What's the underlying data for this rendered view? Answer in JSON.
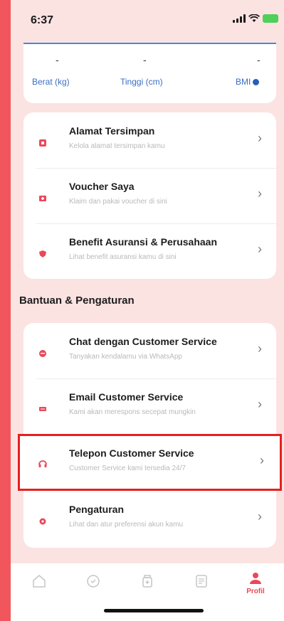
{
  "status_bar": {
    "time": "6:37"
  },
  "metrics": {
    "weight": {
      "value": "-",
      "label": "Berat (kg)"
    },
    "height": {
      "value": "-",
      "label": "Tinggi (cm)"
    },
    "bmi": {
      "value": "-",
      "label": "BMI"
    }
  },
  "account_menu": [
    {
      "title": "Alamat Tersimpan",
      "subtitle": "Kelola alamat tersimpan kamu",
      "icon": "location-icon"
    },
    {
      "title": "Voucher Saya",
      "subtitle": "Klaim dan pakai voucher di sini",
      "icon": "voucher-icon"
    },
    {
      "title": "Benefit Asuransi & Perusahaan",
      "subtitle": "Lihat benefit asuransi kamu di sini",
      "icon": "shield-icon"
    }
  ],
  "help_section": {
    "title": "Bantuan & Pengaturan",
    "items": [
      {
        "title": "Chat dengan Customer Service",
        "subtitle": "Tanyakan kendalamu via WhatsApp",
        "icon": "chat-icon"
      },
      {
        "title": "Email Customer Service",
        "subtitle": "Kami akan merespons secepat mungkin",
        "icon": "email-icon"
      },
      {
        "title": "Telepon Customer Service",
        "subtitle": "Customer Service kami tersedia 24/7",
        "icon": "headset-icon"
      },
      {
        "title": "Pengaturan",
        "subtitle": "Lihat dan atur preferensi akun kamu",
        "icon": "gear-icon"
      }
    ]
  },
  "bottom_nav": {
    "items": [
      {
        "icon": "home-icon",
        "label": ""
      },
      {
        "icon": "health-chat-icon",
        "label": ""
      },
      {
        "icon": "medicine-icon",
        "label": ""
      },
      {
        "icon": "records-icon",
        "label": ""
      },
      {
        "icon": "profile-icon",
        "label": "Profil"
      }
    ]
  },
  "colors": {
    "accent": "#e9485a",
    "highlight": "#e5201f",
    "link": "#3a6fc2"
  }
}
